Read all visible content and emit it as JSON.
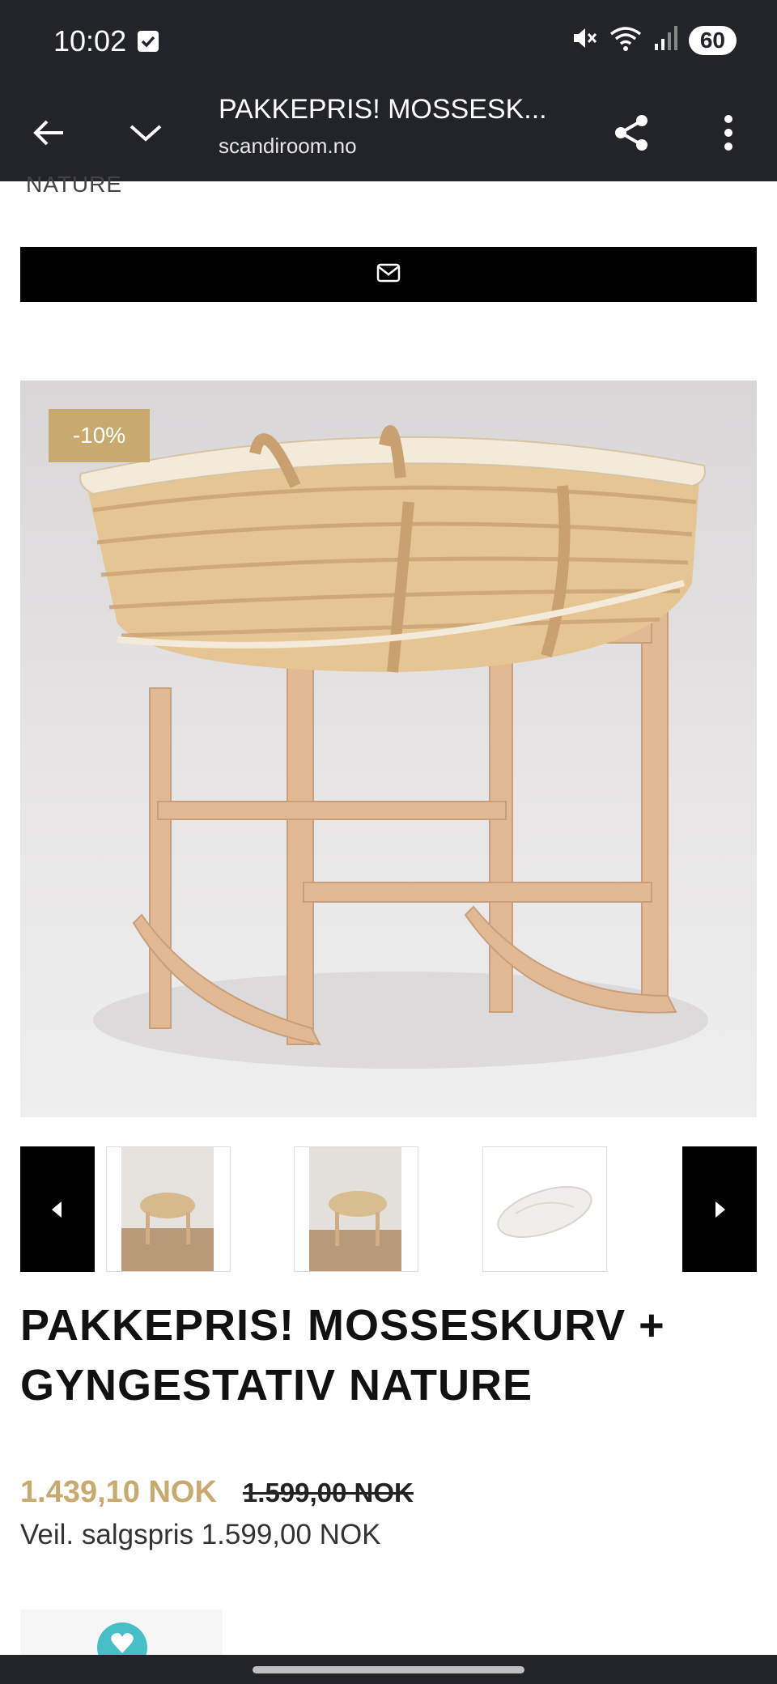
{
  "status_bar": {
    "time": "10:02",
    "battery": "60",
    "icons": [
      "check-notification-icon",
      "mute-icon",
      "wifi-icon",
      "signal-icon"
    ]
  },
  "browser": {
    "title": "PAKKEPRIS! MOSSESK...",
    "url": "scandiroom.no",
    "icons": [
      "back-arrow-icon",
      "chevron-down-icon",
      "share-icon",
      "more-vert-icon"
    ]
  },
  "page": {
    "cut_heading": "NATURE",
    "mail_button_icon": "mail-icon",
    "discount_badge": "-10%",
    "thumbnails": [
      {
        "name": "moses-basket-room-thumb-1"
      },
      {
        "name": "moses-basket-room-thumb-2"
      },
      {
        "name": "mattress-thumb"
      }
    ],
    "product_title": "PAKKEPRIS! MOSSESKURV + GYNGESTATIV NATURE",
    "price_sale": "1.439,10 NOK",
    "price_original": "1.599,00 NOK",
    "recommended_price": "Veil. salgspris 1.599,00 NOK"
  },
  "colors": {
    "system_bar": "#222429",
    "accent_gold": "#c9aa6e",
    "black": "#000000"
  }
}
